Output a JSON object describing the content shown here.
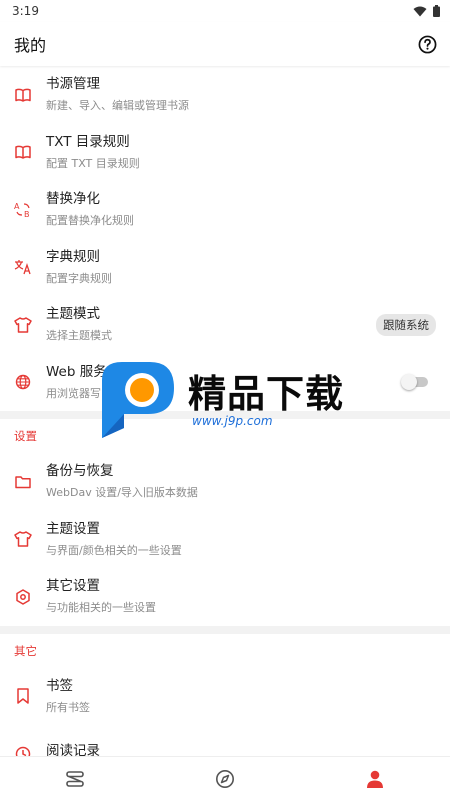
{
  "status": {
    "time": "3:19"
  },
  "appbar": {
    "title": "我的",
    "help_icon": "help-circle-icon"
  },
  "colors": {
    "accent": "#e53935",
    "section_header": "#e53935",
    "nav_active": "#e53935"
  },
  "main_items": [
    {
      "title": "书源管理",
      "subtitle": "新建、导入、编辑或管理书源",
      "icon": "book-open-icon"
    },
    {
      "title": "TXT 目录规则",
      "subtitle": "配置 TXT 目录规则",
      "icon": "book-open-icon"
    },
    {
      "title": "替换净化",
      "subtitle": "配置替换净化规则",
      "icon": "replace-icon"
    },
    {
      "title": "字典规则",
      "subtitle": "配置字典规则",
      "icon": "translate-icon"
    },
    {
      "title": "主题模式",
      "subtitle": "选择主题模式",
      "icon": "tshirt-icon",
      "chip": "跟随系统"
    },
    {
      "title": "Web 服务",
      "subtitle": "用浏览器写",
      "icon": "globe-icon",
      "toggle": false
    }
  ],
  "settings_section": {
    "header": "设置",
    "items": [
      {
        "title": "备份与恢复",
        "subtitle": "WebDav 设置/导入旧版本数据",
        "icon": "folder-icon"
      },
      {
        "title": "主题设置",
        "subtitle": "与界面/颜色相关的一些设置",
        "icon": "tshirt-icon"
      },
      {
        "title": "其它设置",
        "subtitle": "与功能相关的一些设置",
        "icon": "settings-icon"
      }
    ]
  },
  "other_section": {
    "header": "其它",
    "items": [
      {
        "title": "书签",
        "subtitle": "所有书签",
        "icon": "bookmark-icon"
      },
      {
        "title": "阅读记录",
        "subtitle": "",
        "icon": "clock-icon"
      }
    ]
  },
  "bottom_nav": [
    {
      "icon": "bookshelf-icon",
      "active": false
    },
    {
      "icon": "compass-icon",
      "active": false
    },
    {
      "icon": "person-icon",
      "active": true
    }
  ],
  "watermark": {
    "title": "精品下载",
    "url": "www.j9p.com"
  }
}
